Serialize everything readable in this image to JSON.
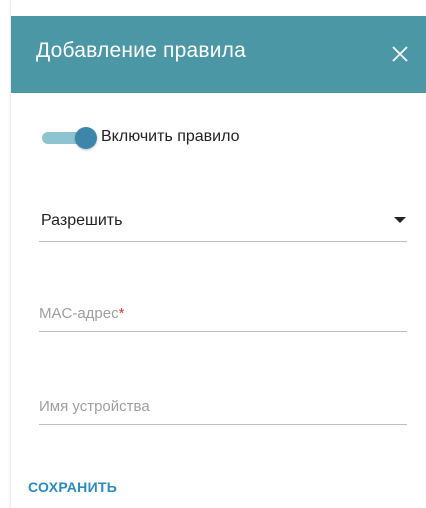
{
  "dialog": {
    "title": "Добавление правила",
    "close_icon": "close-icon"
  },
  "toggle": {
    "label": "Включить правило",
    "checked": true
  },
  "action_select": {
    "value": "Разрешить",
    "arrow_icon": "dropdown-arrow-icon"
  },
  "mac_field": {
    "placeholder": "MAC-адрес",
    "required_mark": "*",
    "value": ""
  },
  "name_field": {
    "placeholder": "Имя устройства",
    "value": ""
  },
  "save_button": {
    "label": "СОХРАНИТЬ"
  },
  "colors": {
    "header": "#4b97a6",
    "toggle_track": "#8ec3d0",
    "toggle_knob": "#3d86ab",
    "save_text": "#2a8bc0",
    "required": "#e53935"
  }
}
